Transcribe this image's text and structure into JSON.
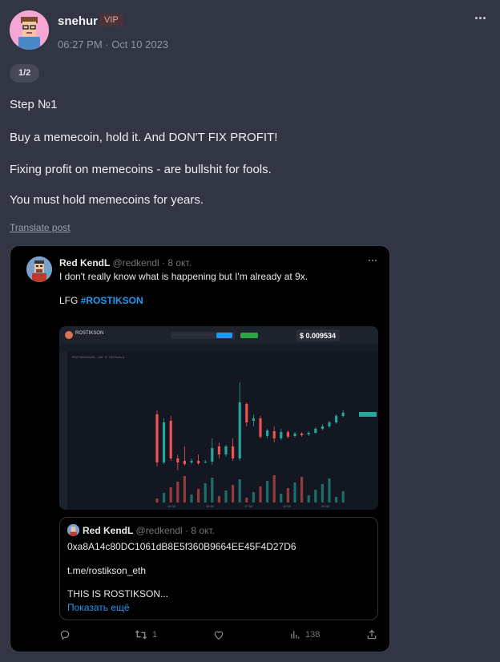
{
  "post": {
    "author": "snehur",
    "badge": "VIP",
    "timestamp": "06:27 PM · Oct 10 2023",
    "page_indicator": "1/2",
    "lines": [
      "Step №1",
      "Buy a memecoin, hold it. And DON'T FIX PROFIT!",
      "Fixing profit on memecoins - are bullshit for fools.",
      "You must hold memecoins for years."
    ],
    "translate_label": "Translate post"
  },
  "tweet": {
    "name": "Red KendL",
    "handle": "@redkendl · 8 окт.",
    "text_line1": "I don't really know what is happening but I'm already at 9x.",
    "text_prefix": "LFG ",
    "hashtag": "#ROSTIKSON",
    "chart": {
      "token": "ROSTIKSON",
      "price": "$ 0.009534",
      "ticker_line": "ROSTIKSON/USD · UNI · 3 · DEXTools.io",
      "x_labels": [
        "14:30",
        "16:00",
        "17:30",
        "19:00",
        "20:30"
      ]
    },
    "quote": {
      "name": "Red KendL",
      "handle": "@redkendl · 8 окт.",
      "address": "0xa8A14c80DC1061dB8E5f360B9664EE45F4D27D6",
      "link": "t.me/rostikson_eth",
      "tagline": "THIS IS ROSTIKSON...",
      "show_more": "Показать ещё"
    },
    "actions": {
      "replies": "",
      "retweets": "1",
      "likes": "",
      "views": "138"
    }
  },
  "colors": {
    "background": "#323644",
    "hashtag": "#1d9bf0",
    "candle_up": "#26a69a",
    "candle_down": "#ef5350"
  }
}
